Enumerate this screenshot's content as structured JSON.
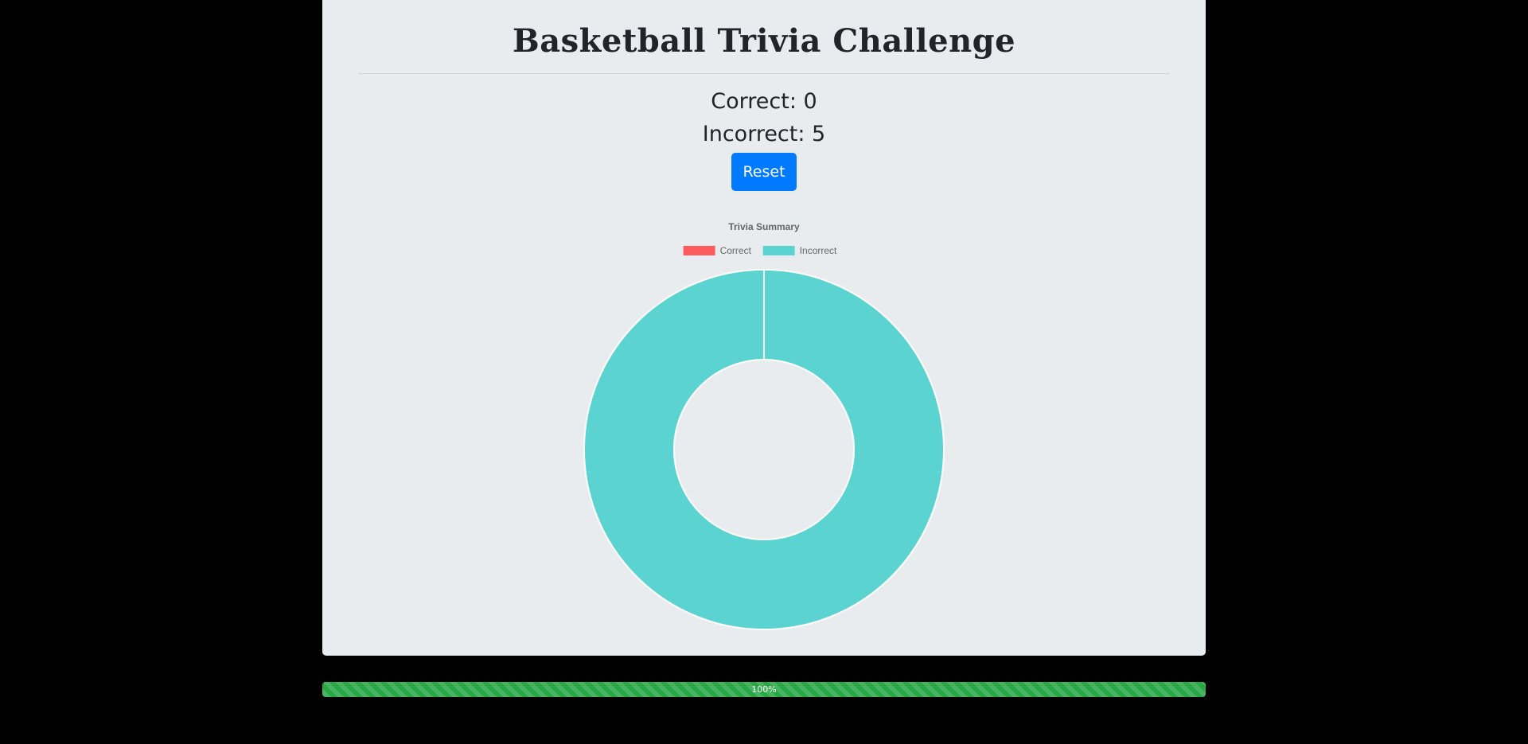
{
  "header": {
    "title": "Basketball Trivia Challenge"
  },
  "scores": {
    "correct_text": "Correct: 0",
    "incorrect_text": "Incorrect: 5"
  },
  "controls": {
    "reset_label": "Reset"
  },
  "chart_data": {
    "type": "pie",
    "variant": "doughnut",
    "title": "Trivia Summary",
    "categories": [
      "Correct",
      "Incorrect"
    ],
    "values": [
      0,
      5
    ],
    "colors": [
      "#ff5a5e",
      "#5ad3d1"
    ],
    "legend_position": "top"
  },
  "progress": {
    "percent": 100,
    "label": "100%",
    "color": "#28a745"
  },
  "colors": {
    "page_background": "#000000",
    "card_background": "#e9ecef",
    "button_primary": "#007bff",
    "text": "#212529"
  }
}
